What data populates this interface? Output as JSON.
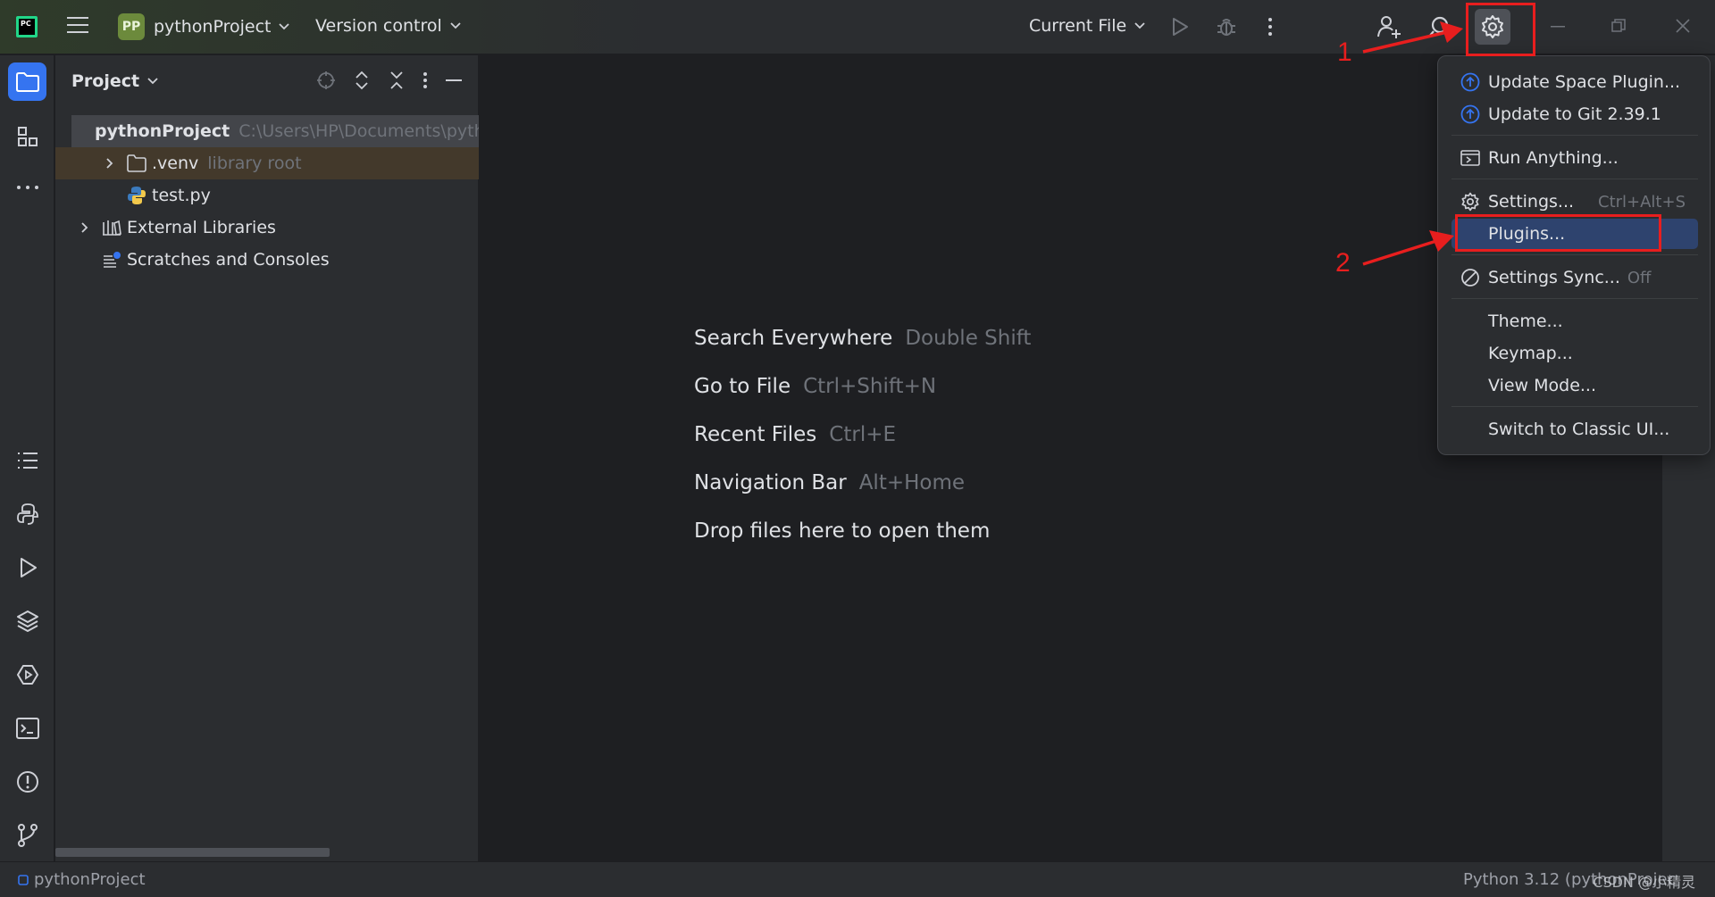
{
  "titlebar": {
    "app_logo_text": "PC",
    "project_badge": "PP",
    "project_name": "pythonProject",
    "vcs_label": "Version control",
    "run_config": "Current File"
  },
  "project_panel": {
    "title": "Project",
    "tree": [
      {
        "label": "pythonProject",
        "detail": "C:\\Users\\HP\\Documents\\pythonProject"
      },
      {
        "label": ".venv",
        "detail": "library root"
      },
      {
        "label": "test.py",
        "detail": ""
      },
      {
        "label": "External Libraries",
        "detail": ""
      },
      {
        "label": "Scratches and Consoles",
        "detail": ""
      }
    ]
  },
  "editor": {
    "hints": [
      {
        "action": "Search Everywhere",
        "shortcut": "Double Shift"
      },
      {
        "action": "Go to File",
        "shortcut": "Ctrl+Shift+N"
      },
      {
        "action": "Recent Files",
        "shortcut": "Ctrl+E"
      },
      {
        "action": "Navigation Bar",
        "shortcut": "Alt+Home"
      },
      {
        "action": "Drop files here to open them",
        "shortcut": ""
      }
    ]
  },
  "menu": {
    "items": [
      {
        "label": "Update Space Plugin...",
        "icon": "update-icon"
      },
      {
        "label": "Update to Git 2.39.1",
        "icon": "update-icon"
      },
      {
        "label": "Run Anything...",
        "icon": "run-anything-icon"
      },
      {
        "label": "Settings...",
        "icon": "gear-icon",
        "shortcut": "Ctrl+Alt+S"
      },
      {
        "label": "Plugins...",
        "icon": ""
      },
      {
        "label": "Settings Sync...",
        "icon": "sync-off-icon",
        "status": "Off"
      },
      {
        "label": "Theme..."
      },
      {
        "label": "Keymap..."
      },
      {
        "label": "View Mode..."
      },
      {
        "label": "Switch to Classic UI..."
      }
    ]
  },
  "annotations": {
    "step1": "1",
    "step2": "2"
  },
  "statusbar": {
    "project": "pythonProject",
    "interpreter": "Python 3.12 (pythonProject)"
  },
  "watermark": "CSDN @小精灵",
  "colors": {
    "accent": "#3574f0",
    "annotation": "#e81e1e",
    "menu_highlight": "#2e436e"
  }
}
